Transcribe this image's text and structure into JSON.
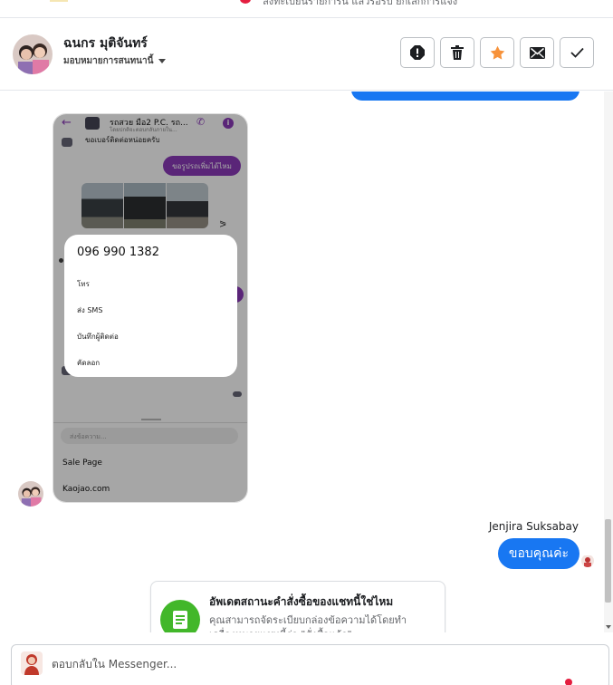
{
  "topbar": {
    "partial_text": "ลงทะเบียนรายการนี้ แล้วรอรับ ยกเลิกการแจ้ง"
  },
  "header": {
    "name": "ฉนกร มุติจันทร์",
    "subtitle": "มอบหมายการสนทนานี้",
    "actions": [
      {
        "name": "report-button",
        "icon": "exclamation-octagon-icon"
      },
      {
        "name": "delete-button",
        "icon": "trash-icon"
      },
      {
        "name": "star-button",
        "icon": "star-icon",
        "color": "#f7923a"
      },
      {
        "name": "mark-unread-button",
        "icon": "envelope-icon"
      },
      {
        "name": "done-button",
        "icon": "checkmark-icon"
      }
    ]
  },
  "screenshot": {
    "header_title": "รถสวย มือ2 P.C. รถ...",
    "header_sub": "โดยปกติจะตอบกลับภายใน...",
    "top_message": "ขอเบอร์ติดต่อหน่อยครับ",
    "purple_message": "ขอรูปรถเพิ่มได้ไหม",
    "popup": {
      "phone": "096 990 1382",
      "options": [
        "โทร",
        "ส่ง SMS",
        "บันทึกผู้ติดต่อ",
        "คัดลอก"
      ]
    },
    "input_placeholder": "ส่งข้อความ...",
    "links": [
      "Sale Page",
      "Kaojao.com"
    ]
  },
  "messages": {
    "sender": "Jenjira Suksabay",
    "reply": "ขอบคุณค่ะ"
  },
  "order_card": {
    "title": "อัพเดตสถานะคำสั่งซื้อของแชทนี้ใช่ไหม",
    "body": "คุณสามารถจัดระเบียบกล่องข้อความได้โดยทำเครื่องหมายแชทนี้ว่า \"สั่งซื้อแล้ว\""
  },
  "composer": {
    "placeholder": "ตอบกลับใน Messenger..."
  },
  "colors": {
    "primary": "#1877f2",
    "purple": "#8a3ab9",
    "green": "#42b72a",
    "star": "#f7923a"
  }
}
